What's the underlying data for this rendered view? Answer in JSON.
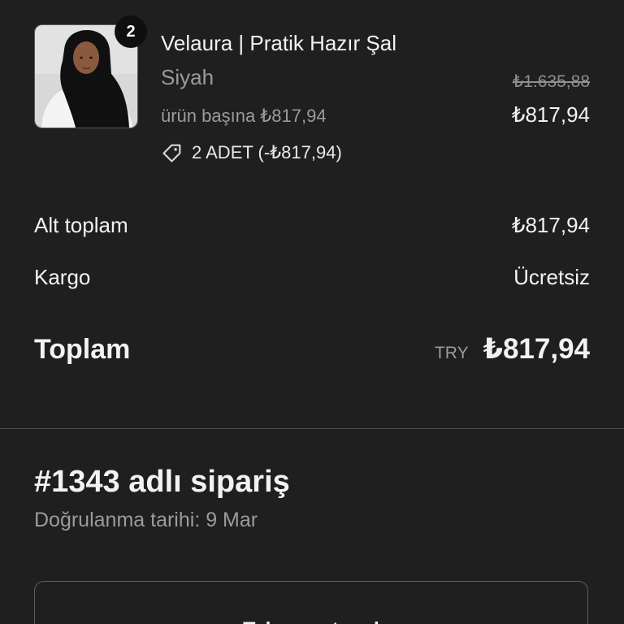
{
  "item": {
    "quantity_badge": "2",
    "title": "Velaura | Pratik Hazır Şal",
    "variant": "Siyah",
    "unit_price_text": "ürün başına ₺817,94",
    "original_price": "₺1.635,88",
    "price": "₺817,94",
    "discount_icon": "tag-icon",
    "discount_text": "2 ADET  (-₺817,94)"
  },
  "summary": {
    "subtotal_label": "Alt toplam",
    "subtotal_value": "₺817,94",
    "shipping_label": "Kargo",
    "shipping_value": "Ücretsiz",
    "total_label": "Toplam",
    "currency_code": "TRY",
    "total_value": "₺817,94"
  },
  "order": {
    "title": "#1343 adlı sipariş",
    "confirmed": "Doğrulanma tarihi: 9 Mar",
    "reorder_label": "Tekrar satın al"
  },
  "colors": {
    "background": "#1f1f1f",
    "text_primary": "#f2f2f2",
    "text_secondary": "#9b9b9b",
    "divider": "#4a4a4a",
    "badge": "#0f0f0f"
  }
}
